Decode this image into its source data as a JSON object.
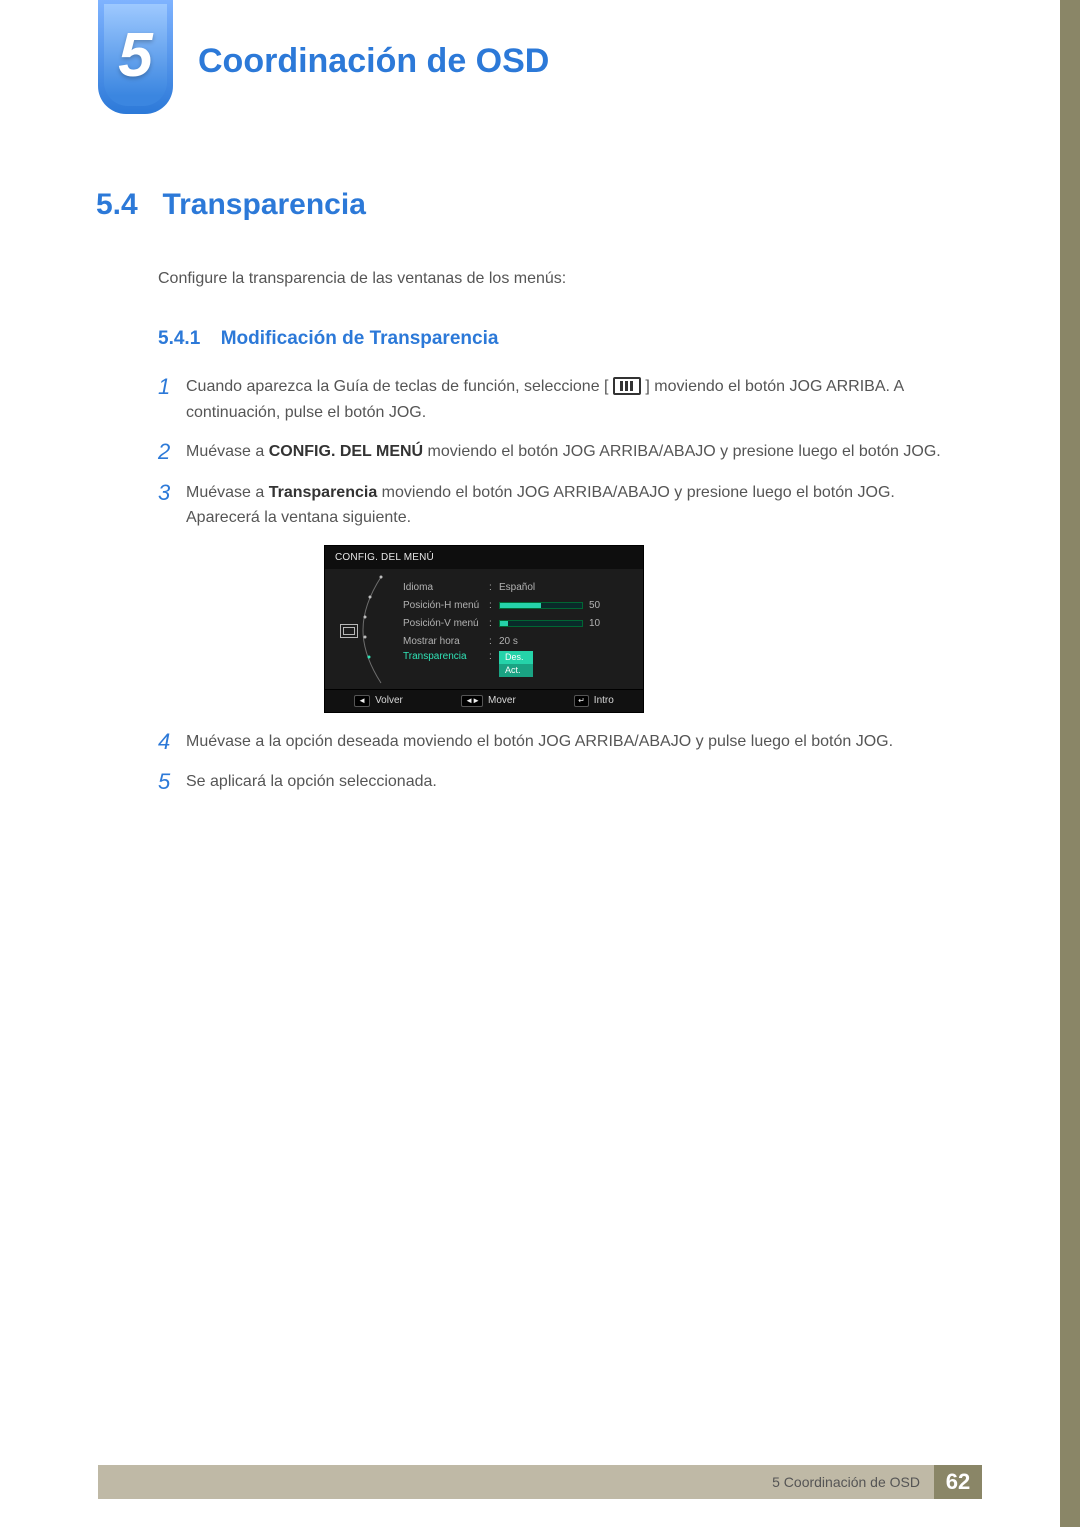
{
  "chapter": {
    "number": "5",
    "title": "Coordinación de OSD"
  },
  "section": {
    "number": "5.4",
    "title": "Transparencia"
  },
  "intro": "Configure la transparencia de las ventanas de los menús:",
  "subsection": {
    "number": "5.4.1",
    "title": "Modificación de Transparencia"
  },
  "steps": {
    "s1_a": "Cuando aparezca la Guía de teclas de función, seleccione [",
    "s1_b": "] moviendo el botón JOG ARRIBA. A continuación, pulse el botón JOG.",
    "s2_a": "Muévase a ",
    "s2_bold": "CONFIG. DEL MENÚ",
    "s2_b": " moviendo el botón JOG ARRIBA/ABAJO y presione luego el botón JOG.",
    "s3_a": "Muévase a ",
    "s3_bold": "Transparencia",
    "s3_b": " moviendo el botón JOG ARRIBA/ABAJO y presione luego el botón JOG.",
    "s3_c": "Aparecerá la ventana siguiente.",
    "s4": "Muévase a la opción deseada moviendo el botón JOG ARRIBA/ABAJO y pulse luego el botón JOG.",
    "s5": "Se aplicará la opción seleccionada."
  },
  "osd": {
    "title": "CONFIG. DEL MENÚ",
    "rows": {
      "idioma": {
        "label": "Idioma",
        "value": "Español"
      },
      "posh": {
        "label": "Posición-H menú",
        "value": "50",
        "pct": 50
      },
      "posv": {
        "label": "Posición-V menú",
        "value": "10",
        "pct": 10
      },
      "mostrar": {
        "label": "Mostrar hora",
        "value": "20 s"
      },
      "transp": {
        "label": "Transparencia",
        "opt1": "Des.",
        "opt2": "Act."
      }
    },
    "footer": {
      "back_key": "◄",
      "back": "Volver",
      "move_key": "◄►",
      "move": "Mover",
      "enter_key": "↵",
      "enter": "Intro"
    }
  },
  "footer": {
    "text": "5 Coordinación de OSD",
    "page": "62"
  }
}
